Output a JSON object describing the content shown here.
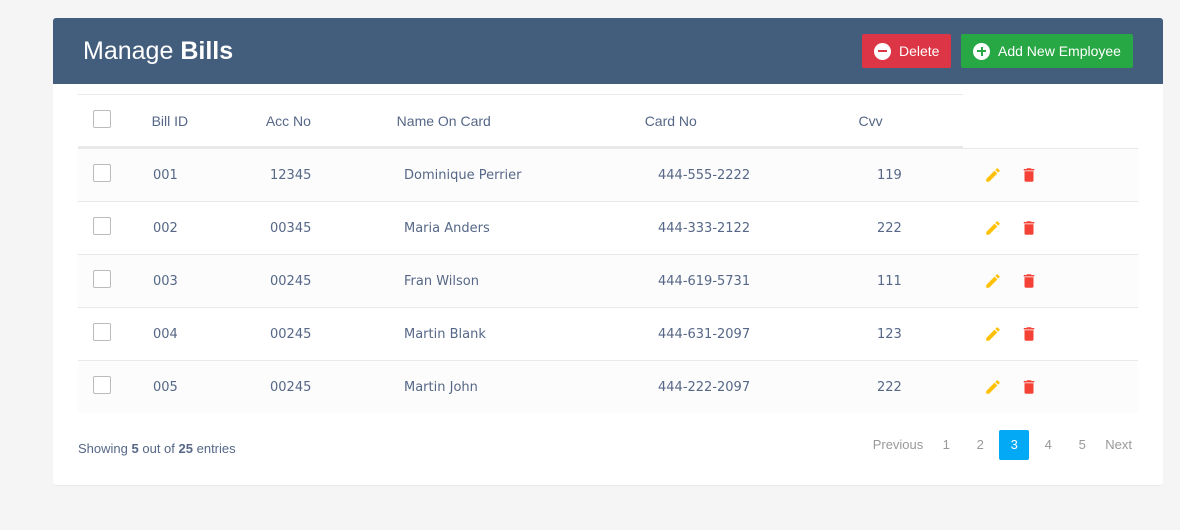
{
  "header": {
    "title_prefix": "Manage",
    "title_bold": "Bills",
    "delete_label": "Delete",
    "add_label": "Add New Employee"
  },
  "table": {
    "columns": [
      "Bill ID",
      "Acc No",
      "Name On Card",
      "Card No",
      "Cvv"
    ],
    "rows": [
      {
        "bill_id": "001",
        "acc_no": "12345",
        "name": "Dominique Perrier",
        "card_no": "444-555-2222",
        "cvv": "119"
      },
      {
        "bill_id": "002",
        "acc_no": "00345",
        "name": "Maria Anders",
        "card_no": "444-333-2122",
        "cvv": "222"
      },
      {
        "bill_id": "003",
        "acc_no": "00245",
        "name": "Fran Wilson",
        "card_no": "444-619-5731",
        "cvv": "111"
      },
      {
        "bill_id": "004",
        "acc_no": "00245",
        "name": "Martin Blank",
        "card_no": "444-631-2097",
        "cvv": "123"
      },
      {
        "bill_id": "005",
        "acc_no": "00245",
        "name": "Martin John",
        "card_no": "444-222-2097",
        "cvv": "222"
      }
    ]
  },
  "footer": {
    "showing_prefix": "Showing",
    "shown_count": "5",
    "out_of": "out of",
    "total": "25",
    "entries": "entries"
  },
  "pagination": {
    "previous": "Previous",
    "pages": [
      "1",
      "2",
      "3",
      "4",
      "5"
    ],
    "active_page": "3",
    "next": "Next"
  },
  "colors": {
    "header_bg": "#435d7d",
    "delete": "#dc3545",
    "add": "#28a745",
    "edit_icon": "#ffc107",
    "delete_icon": "#f44336",
    "active_page": "#03a9f4"
  },
  "icons": {
    "edit": "pencil-icon",
    "delete": "trash-icon"
  }
}
